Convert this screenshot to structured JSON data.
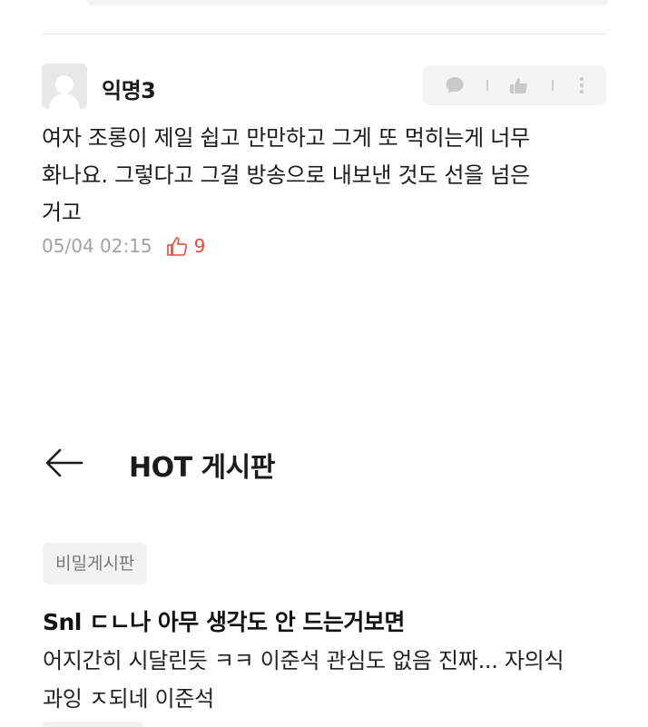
{
  "comment": {
    "author": "익명3",
    "text": "여자 조롱이 제일 쉽고 만만하고 그게 또 먹히는게 너무\n화나요. 그렇다고 그걸 방송으로 내보낸 것도 선을 넘은\n거고",
    "timestamp": "05/04 02:15",
    "like_count": "9",
    "actions": [
      "reply-icon",
      "thumbs-up-icon",
      "more-icon"
    ]
  },
  "board": {
    "title": "HOT 게시판"
  },
  "post": {
    "category": "비밀게시판",
    "title": "Snl ㄷㄴ나 아무 생각도 안 드는거보면",
    "body": "어지간히 시달린듯 ㅋㅋ 이준석 관심도 없음 진짜... 자의식\n과잉 ㅈ되네 이준석"
  },
  "colors": {
    "like_red": "#e04a3a",
    "meta_gray": "#a2a2a2",
    "chip_bg": "#f2f2f2"
  }
}
